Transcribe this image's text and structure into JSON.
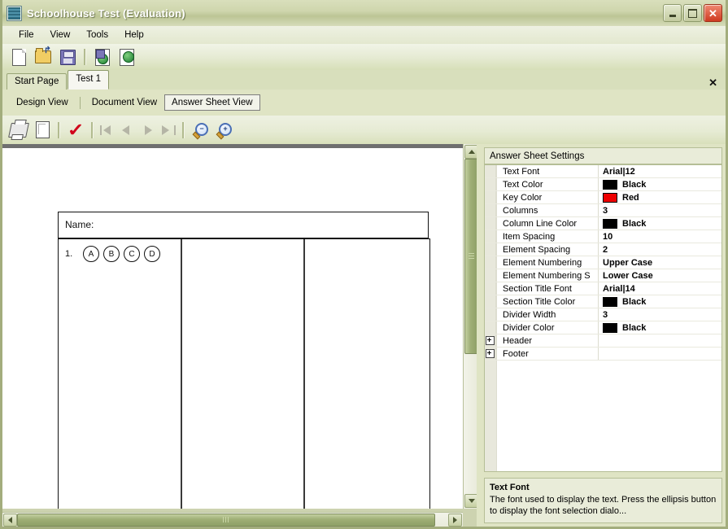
{
  "window": {
    "title": "Schoolhouse Test (Evaluation)",
    "app_icon": "list-document-icon",
    "minimize_label": "",
    "maximize_label": "",
    "close_label": "✕"
  },
  "menu": {
    "items": [
      {
        "label": "File"
      },
      {
        "label": "View"
      },
      {
        "label": "Tools"
      },
      {
        "label": "Help"
      }
    ]
  },
  "toolbar_main": {
    "buttons": [
      {
        "name": "new-document-button",
        "icon": "new-page-icon"
      },
      {
        "name": "open-file-button",
        "icon": "open-folder-icon"
      },
      {
        "name": "save-button",
        "icon": "floppy-disk-icon"
      },
      {
        "name": "save-as-web-button",
        "icon": "save-web-icon"
      },
      {
        "name": "publish-web-button",
        "icon": "globe-page-icon"
      }
    ]
  },
  "tabs": {
    "items": [
      {
        "label": "Start Page",
        "active": false
      },
      {
        "label": "Test 1",
        "active": true
      }
    ],
    "close_label": "✕"
  },
  "views": {
    "items": [
      {
        "label": "Design View",
        "selected": false
      },
      {
        "label": "Document View",
        "selected": false
      },
      {
        "label": "Answer Sheet View",
        "selected": true
      }
    ]
  },
  "toolbar_preview": {
    "buttons": [
      {
        "name": "print-button",
        "icon": "printer-icon"
      },
      {
        "name": "print-preview-button",
        "icon": "page-preview-icon"
      },
      {
        "name": "answer-key-button",
        "icon": "red-check-icon"
      },
      {
        "name": "first-page-button",
        "icon": "first-page-icon"
      },
      {
        "name": "previous-page-button",
        "icon": "previous-page-icon"
      },
      {
        "name": "next-page-button",
        "icon": "next-page-icon"
      },
      {
        "name": "last-page-button",
        "icon": "last-page-icon"
      },
      {
        "name": "zoom-out-button",
        "icon": "zoom-out-icon",
        "glyph": "−"
      },
      {
        "name": "zoom-in-button",
        "icon": "zoom-in-icon",
        "glyph": "+"
      }
    ]
  },
  "answer_sheet": {
    "name_label": "Name:",
    "columns": 3,
    "questions": [
      {
        "number": "1.",
        "bubbles": [
          "A",
          "B",
          "C",
          "D"
        ]
      }
    ]
  },
  "properties": {
    "header_title": "Answer Sheet Settings",
    "rows": [
      {
        "name": "Text Font",
        "value": "Arial|12",
        "swatch": null,
        "expander": false
      },
      {
        "name": "Text Color",
        "value": "Black",
        "swatch": "#000000",
        "expander": false
      },
      {
        "name": "Key Color",
        "value": "Red",
        "swatch": "#ee0000",
        "expander": false
      },
      {
        "name": "Columns",
        "value": "3",
        "swatch": null,
        "expander": false
      },
      {
        "name": "Column Line Color",
        "value": "Black",
        "swatch": "#000000",
        "expander": false
      },
      {
        "name": "Item Spacing",
        "value": "10",
        "swatch": null,
        "expander": false
      },
      {
        "name": "Element Spacing",
        "value": "2",
        "swatch": null,
        "expander": false
      },
      {
        "name": "Element Numbering",
        "value": "Upper Case",
        "swatch": null,
        "expander": false
      },
      {
        "name": "Element Numbering S",
        "value": "Lower Case",
        "swatch": null,
        "expander": false
      },
      {
        "name": "Section Title Font",
        "value": "Arial|14",
        "swatch": null,
        "expander": false
      },
      {
        "name": "Section Title Color",
        "value": "Black",
        "swatch": "#000000",
        "expander": false
      },
      {
        "name": "Divider Width",
        "value": "3",
        "swatch": null,
        "expander": false
      },
      {
        "name": "Divider Color",
        "value": "Black",
        "swatch": "#000000",
        "expander": false
      },
      {
        "name": "Header",
        "value": "",
        "swatch": null,
        "expander": true
      },
      {
        "name": "Footer",
        "value": "",
        "swatch": null,
        "expander": true
      }
    ],
    "description": {
      "title": "Text Font",
      "text": "The font used to display the text. Press the ellipsis button to display the font selection dialo..."
    }
  },
  "colors": {
    "titlebar_green": "#cfd6ad",
    "panel_green": "#dfe4c4",
    "accent_red": "#d0021b",
    "scrollbar_thumb": "#9eae75"
  }
}
